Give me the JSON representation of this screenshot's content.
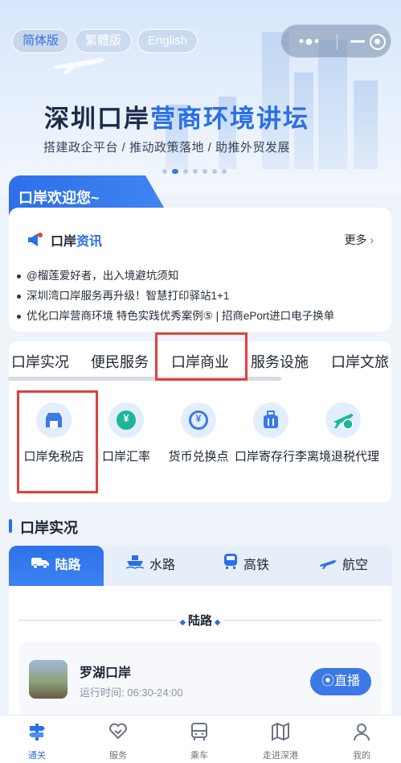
{
  "banner": {
    "languages": [
      "简体版",
      "繁體版",
      "English"
    ],
    "title_part1": "深圳口岸",
    "title_part2": "营商环境讲坛",
    "subtitle": "搭建政企平台 / 推动政策落地 / 助推外贸发展"
  },
  "welcome": {
    "tab_label": "口岸欢迎您~",
    "news_title_part1": "口岸",
    "news_title_part2": "资讯",
    "more_label": "更多",
    "news_items": [
      "@榴莲爱好者，出入境避坑须知",
      "深圳湾口岸服务再升级！智慧打印驿站1+1",
      "优化口岸营商环境 特色实践优秀案例⑤ | 招商ePort进口电子换单"
    ]
  },
  "categories": {
    "tabs": [
      "口岸实况",
      "便民服务",
      "口岸商业",
      "服务设施",
      "口岸文旅"
    ],
    "services": [
      {
        "label": "口岸免税店",
        "icon": "store-icon"
      },
      {
        "label": "口岸汇率",
        "icon": "exchange-rate-icon"
      },
      {
        "label": "货币兑换点",
        "icon": "currency-exchange-icon"
      },
      {
        "label": "口岸寄存行李",
        "icon": "luggage-icon"
      },
      {
        "label": "离境退税代理",
        "icon": "tax-refund-icon"
      }
    ]
  },
  "port_status": {
    "section_title": "口岸实况",
    "modes": [
      "陆路",
      "水路",
      "高铁",
      "航空"
    ],
    "panel_heading": "陆路",
    "port": {
      "name": "罗湖口岸",
      "hours": "运行时间: 06:30-24:00",
      "live_label": "直播"
    }
  },
  "bottom_nav": [
    "通关",
    "服务",
    "乘车",
    "走进深港",
    "我的"
  ],
  "colors": {
    "accent": "#2a6fe6",
    "highlight": "#e2403c"
  }
}
